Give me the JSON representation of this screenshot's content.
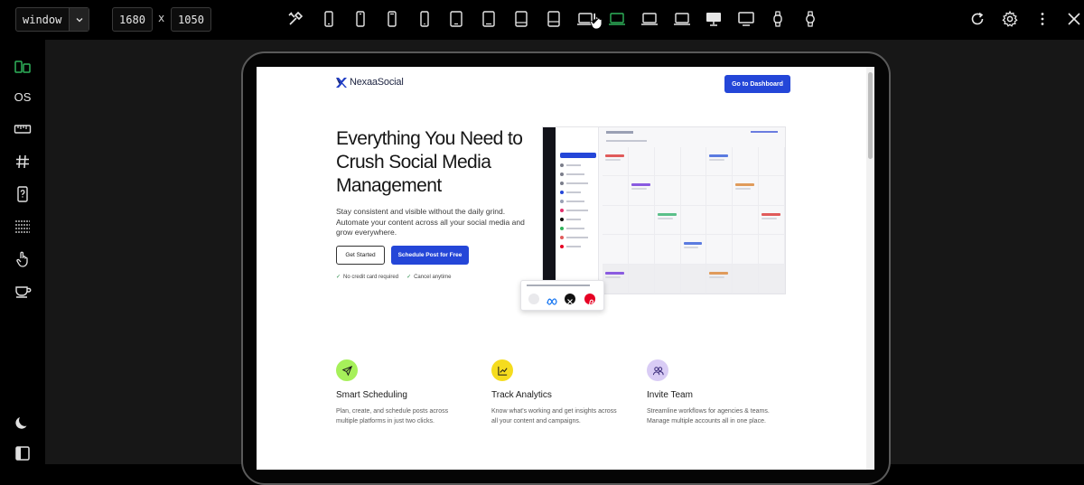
{
  "toolbar": {
    "mode_select": "window",
    "width": "1680",
    "height": "1050",
    "dimension_separator": "x",
    "device_icons": [
      "tools-icon",
      "phone-icon",
      "phone-icon",
      "phone-icon",
      "phone-icon",
      "tablet-icon",
      "tablet-icon",
      "tablet-icon",
      "tablet-icon",
      "laptop-icon",
      "laptop-icon",
      "laptop-icon",
      "laptop-icon",
      "desktop-icon",
      "desktop-icon",
      "watch-icon",
      "watch-icon"
    ],
    "active_device_index": 10,
    "active_color": "#2fb35a"
  },
  "rail": {
    "os_label": "OS"
  },
  "site": {
    "brand": "NexaaSocial",
    "top_cta": "Go to Dashboard",
    "hero_title": "Everything You Need to Crush Social Media Management",
    "hero_subtitle": "Stay consistent and visible without the daily grind. Automate your content across all your social media and grow everywhere.",
    "btn_secondary": "Get Started",
    "btn_primary": "Schedule Post for Free",
    "check_1": "No credit card required",
    "check_2": "Cancel anytime",
    "accent_color": "#2446d8",
    "features": [
      {
        "title": "Smart Scheduling",
        "desc": "Plan, create, and schedule posts across multiple platforms in just two clicks.",
        "icon": "send-icon",
        "color": "#a6f05a"
      },
      {
        "title": "Track Analytics",
        "desc": "Know what's working and get insights across all your content and campaigns.",
        "icon": "chart-line-icon",
        "color": "#f5dc1e"
      },
      {
        "title": "Invite Team",
        "desc": "Streamline workflows for agencies & teams. Manage multiple accounts all in one place.",
        "icon": "users-icon",
        "color": "#d9ccf5"
      }
    ]
  }
}
